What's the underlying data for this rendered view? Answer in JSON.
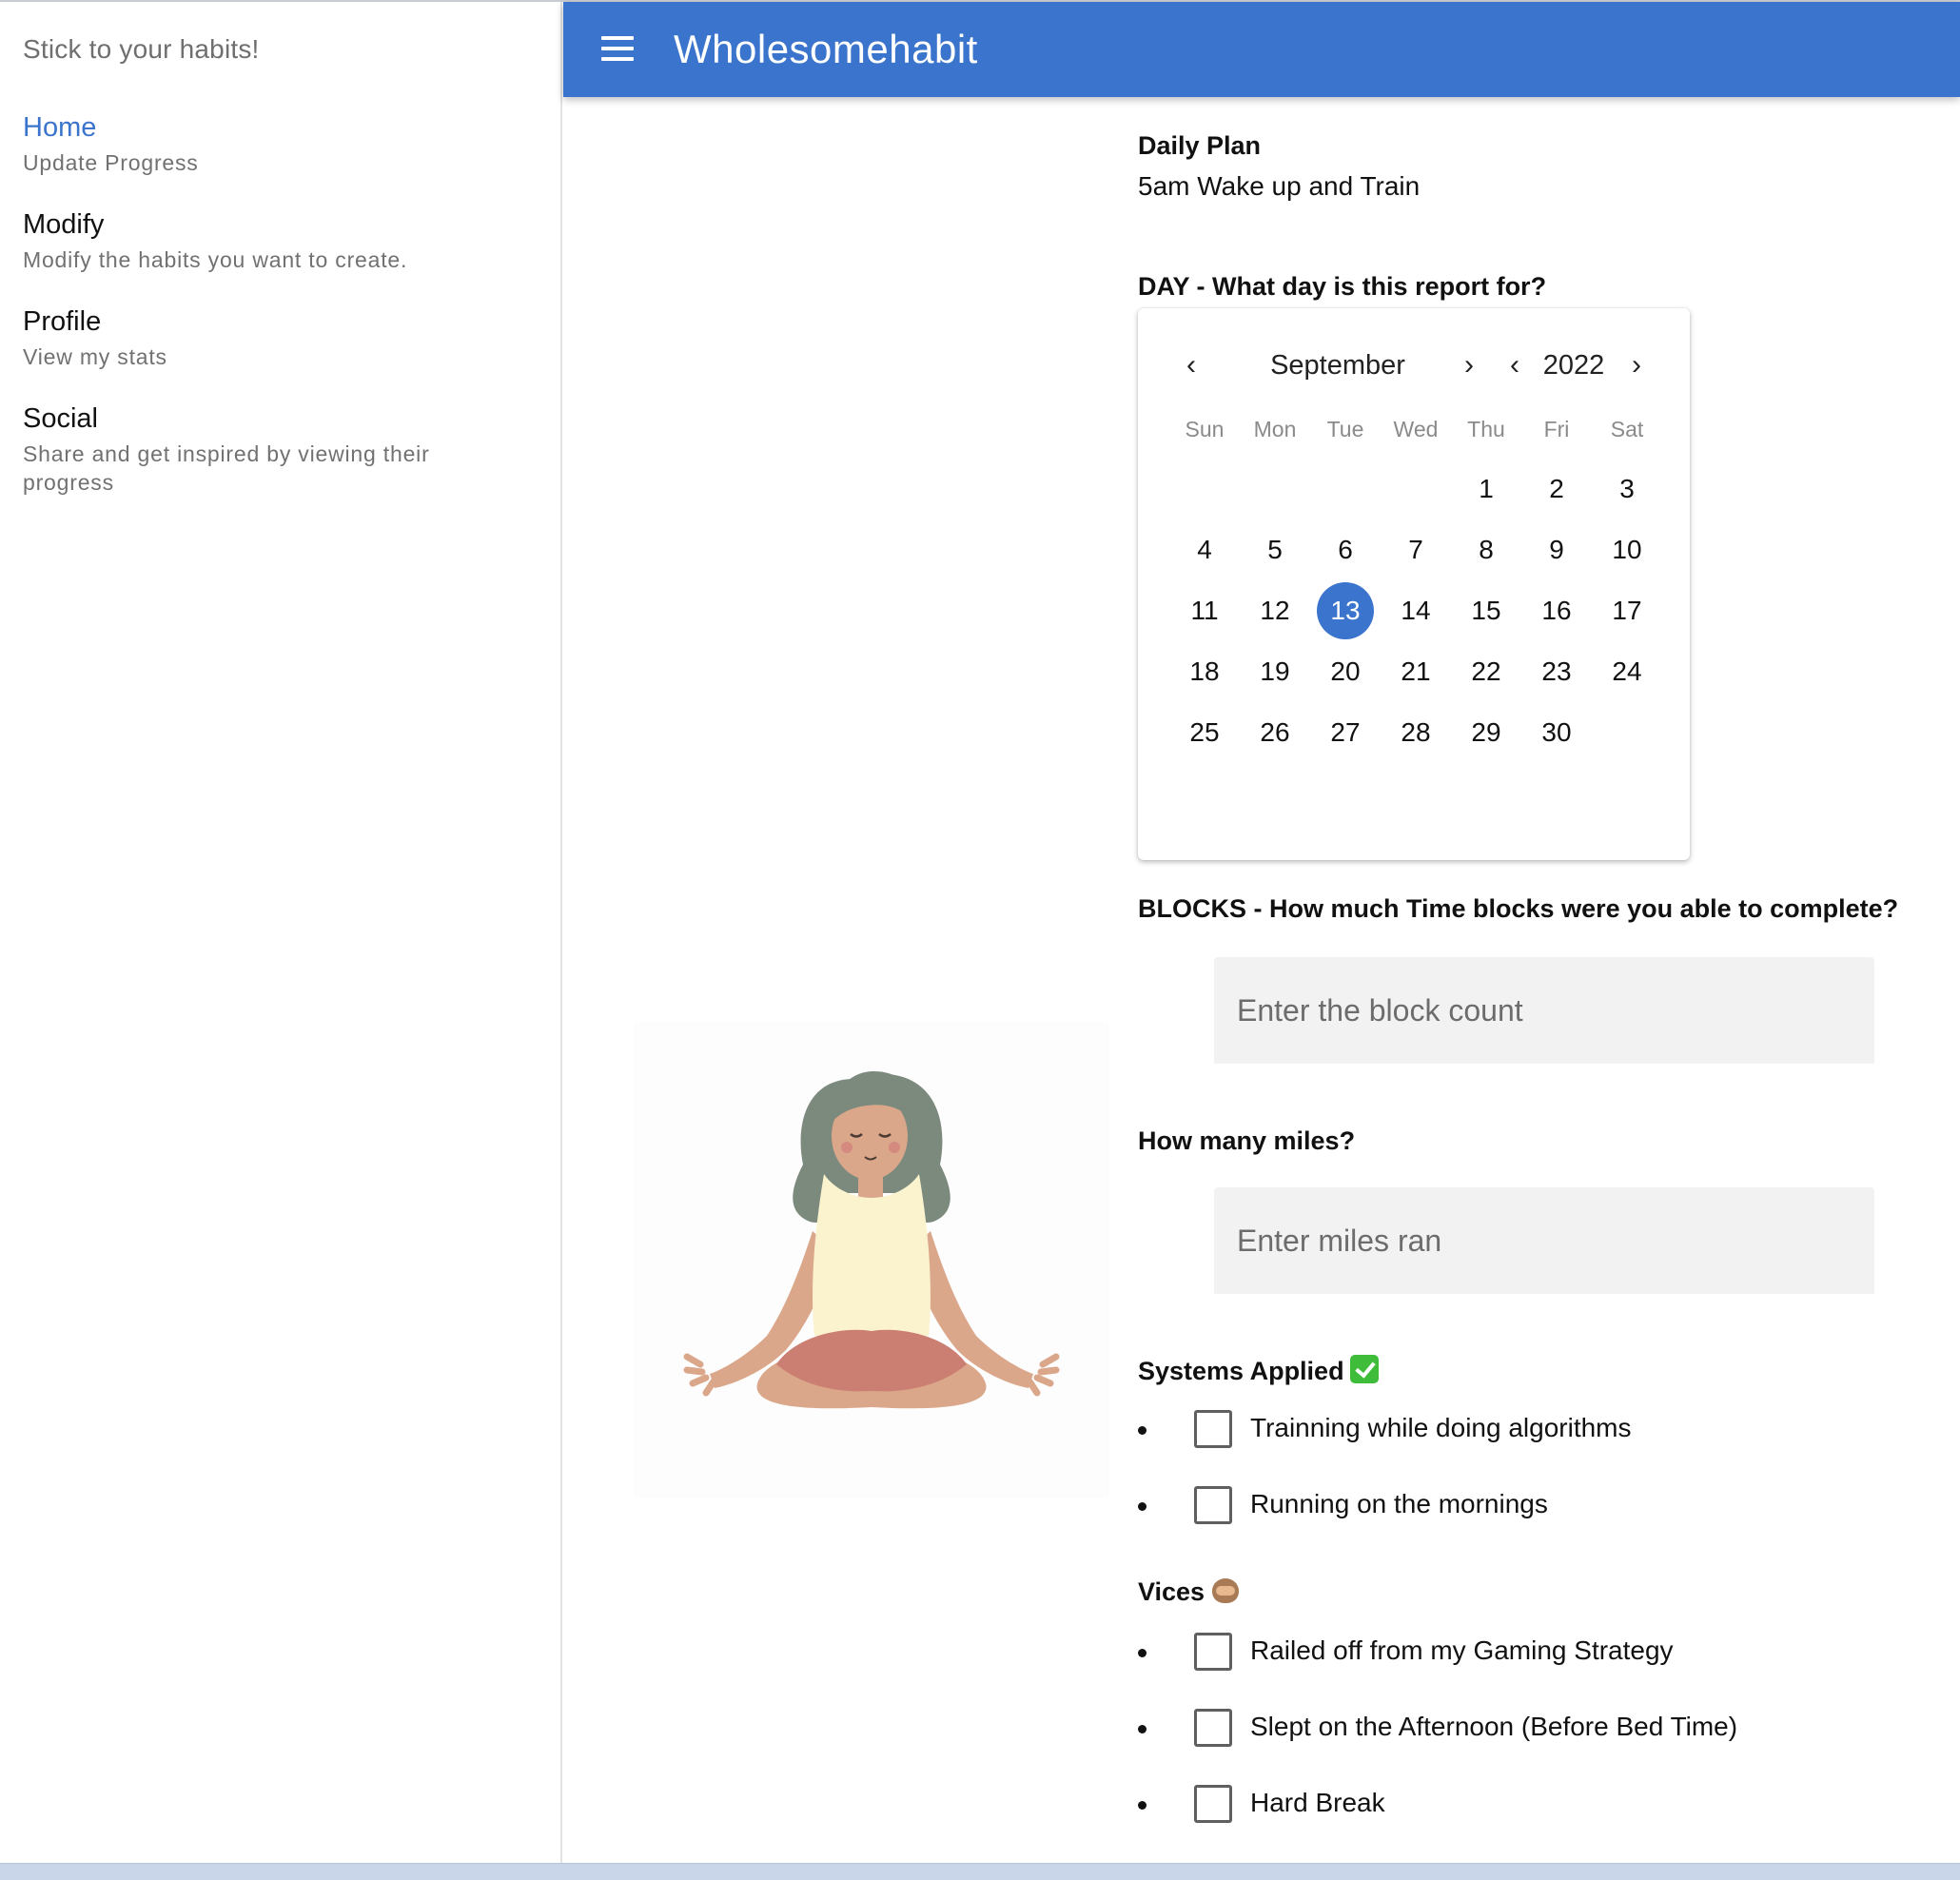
{
  "sidebar": {
    "tagline": "Stick to your habits!",
    "items": [
      {
        "title": "Home",
        "subtitle": "Update Progress"
      },
      {
        "title": "Modify",
        "subtitle": "Modify the habits you want to create."
      },
      {
        "title": "Profile",
        "subtitle": "View my stats"
      },
      {
        "title": "Social",
        "subtitle": "Share and get inspired by viewing their progress"
      }
    ]
  },
  "appbar": {
    "title": "Wholesomehabit",
    "color": "#3a74cc"
  },
  "daily_plan": {
    "label": "Daily Plan",
    "value": "5am Wake up and Train"
  },
  "day_section": {
    "label": "DAY - What day is this report for?"
  },
  "calendar": {
    "month": "September",
    "year": "2022",
    "weekdays": [
      "Sun",
      "Mon",
      "Tue",
      "Wed",
      "Thu",
      "Fri",
      "Sat"
    ],
    "first_weekday_index": 4,
    "days_in_month": 30,
    "selected_day": 13,
    "selected_color": "#3a74cc"
  },
  "blocks": {
    "label": "BLOCKS - How much Time blocks were you able to complete?",
    "placeholder": "Enter the block count"
  },
  "miles": {
    "label": "How many miles?",
    "placeholder": "Enter miles ran"
  },
  "systems": {
    "label": "Systems Applied",
    "emoji": "check-mark-button-icon",
    "items": [
      "Trainning while doing algorithms",
      "Running on the mornings"
    ]
  },
  "vices": {
    "label": "Vices",
    "emoji": "see-no-evil-monkey-icon",
    "items": [
      "Railed off from my Gaming Strategy",
      "Slept on the Afternoon (Before Bed Time)",
      "Hard Break"
    ]
  }
}
